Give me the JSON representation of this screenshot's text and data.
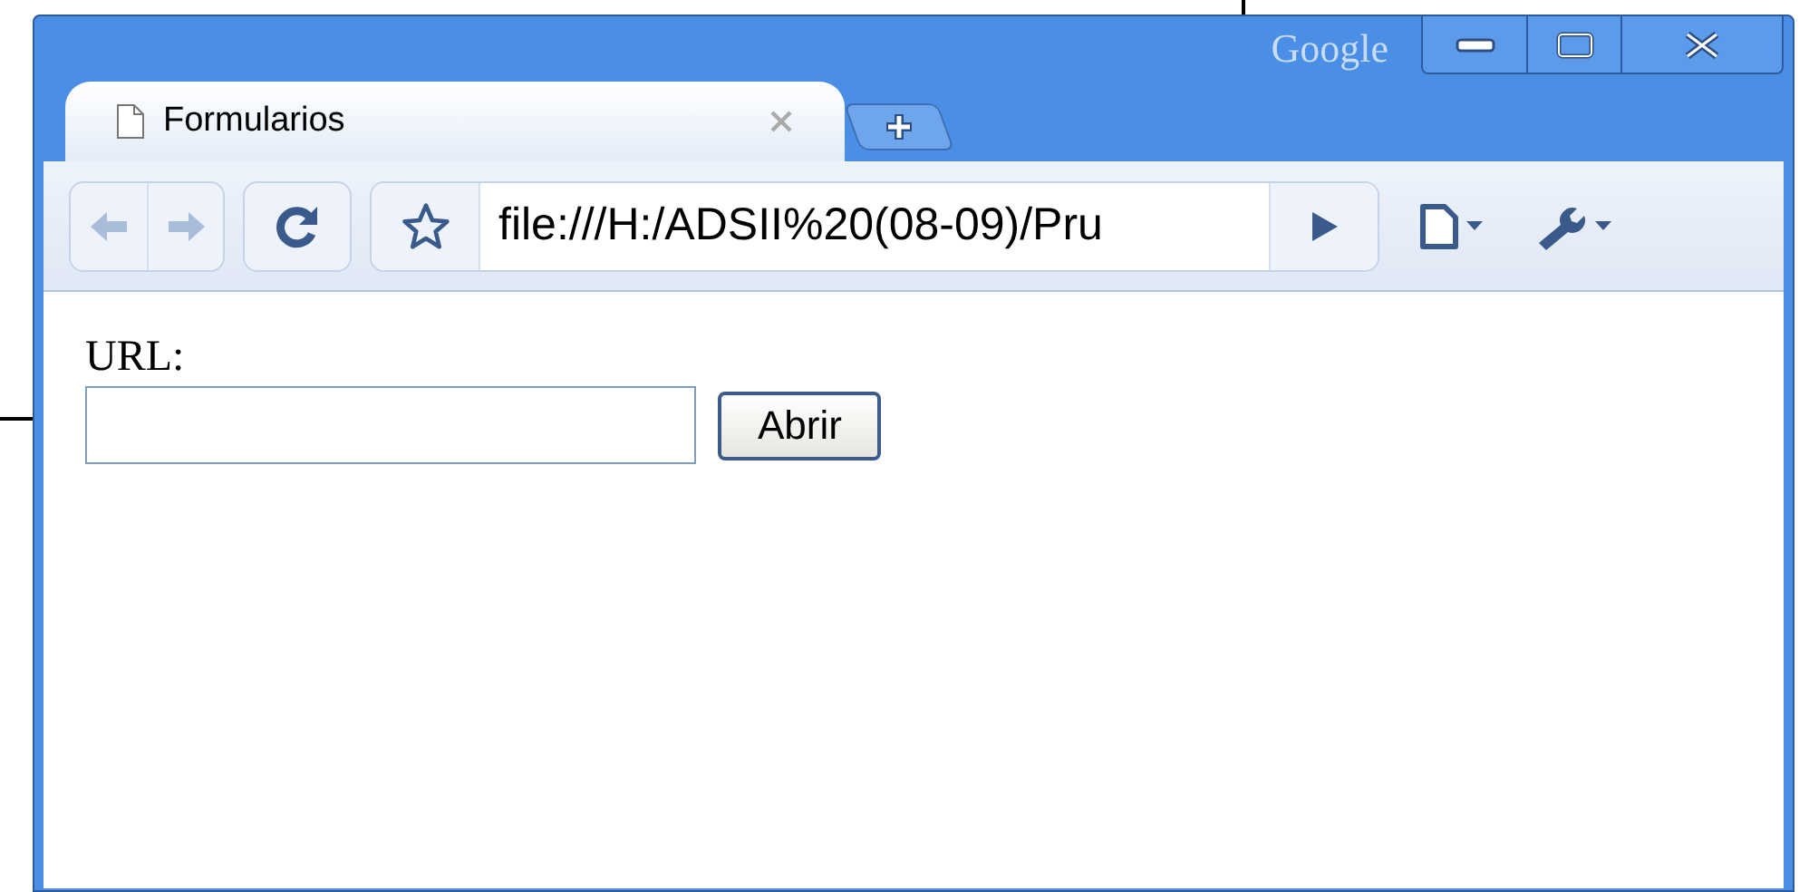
{
  "window": {
    "brand": "Google"
  },
  "tabs": [
    {
      "title": "Formularios",
      "selected": true
    }
  ],
  "nav_buttons": [
    {
      "kind": "back",
      "disabled": true
    },
    {
      "kind": "forward",
      "disabled": true
    }
  ],
  "address_bar": {
    "value": "file:///H:/ADSII%20(08-09)/Pru"
  },
  "page": {
    "label": "URL:",
    "button": "Abrir"
  }
}
